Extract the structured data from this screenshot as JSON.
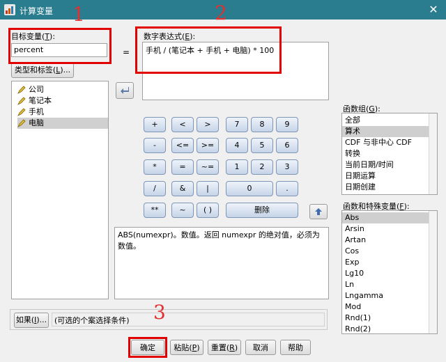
{
  "window": {
    "title": "计算变量",
    "close_glyph": "✕"
  },
  "target_variable": {
    "label": "目标变量(",
    "mnemonic": "T",
    "label_end": "):",
    "value": "percent"
  },
  "type_label_button": {
    "label_pre": "类型和标签(",
    "mnemonic": "L",
    "label_end": ")..."
  },
  "equals_sign": "=",
  "numeric_expression": {
    "label": "数字表达式(",
    "mnemonic": "E",
    "label_end": "):",
    "value": "手机 / (笔记本 + 手机 + 电脑) * 100"
  },
  "variables": [
    "公司",
    "笔记本",
    "手机",
    "电脑"
  ],
  "keypad": {
    "row1": [
      "+",
      "<",
      ">",
      "7",
      "8",
      "9"
    ],
    "row2": [
      "-",
      "<=",
      ">=",
      "4",
      "5",
      "6"
    ],
    "row3": [
      "*",
      "=",
      "~=",
      "1",
      "2",
      "3"
    ],
    "row4": [
      "/",
      "&",
      "|",
      "0",
      "."
    ],
    "row5": [
      "**",
      "~",
      "( )",
      "删除"
    ]
  },
  "function_group": {
    "label": "函数组(",
    "mnemonic": "G",
    "label_end": "):",
    "items": [
      "全部",
      "算术",
      "CDF 与非中心 CDF",
      "转换",
      "当前日期/时间",
      "日期运算",
      "日期创建"
    ],
    "selected_index": 1
  },
  "functions": {
    "label": "函数和特殊变量(",
    "mnemonic": "F",
    "label_end": "):",
    "items": [
      "Abs",
      "Arsin",
      "Artan",
      "Cos",
      "Exp",
      "Lg10",
      "Ln",
      "Lngamma",
      "Mod",
      "Rnd(1)",
      "Rnd(2)"
    ],
    "selected_index": 0
  },
  "description": "ABS(numexpr)。数值。返回 numexpr 的绝对值，必须为数值。",
  "if_button": {
    "label_pre": "如果(",
    "mnemonic": "I",
    "label_end": ")..."
  },
  "if_condition": "(可选的个案选择条件)",
  "buttons": {
    "ok": "确定",
    "paste_pre": "粘贴(",
    "paste_mn": "P",
    "paste_end": ")",
    "reset_pre": "重置(",
    "reset_mn": "R",
    "reset_end": ")",
    "cancel": "取消",
    "help": "帮助"
  },
  "annotations": [
    "1",
    "2",
    "3"
  ],
  "colors": {
    "titlebar": "#2a7c8f",
    "annotation_red": "#e00000"
  }
}
